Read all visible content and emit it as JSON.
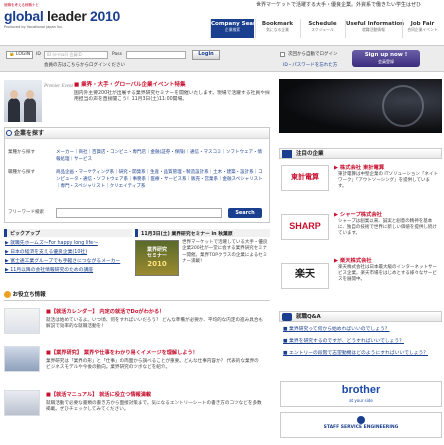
{
  "header": {
    "logo_small": "就職を考える就職ナビ",
    "logo_main_a": "global ",
    "logo_main_b": "leader",
    "logo_main_c": " 2010",
    "logo_sub": "Produced by Vocational Japan Inc.",
    "tagline": "世界マーケットで活躍する大手・優良企業。外資系で働きたい学生はぜひ",
    "nav": [
      {
        "label": "Company Search",
        "sub": "企業検索",
        "active": true
      },
      {
        "label": "Bookmark",
        "sub": "気になる企業",
        "active": false
      },
      {
        "label": "Schedule",
        "sub": "スケジュール",
        "active": false
      },
      {
        "label": "Useful Information",
        "sub": "就職活動情報",
        "active": false
      },
      {
        "label": "Job Fair",
        "sub": "合同企業イベント",
        "active": false
      }
    ]
  },
  "login": {
    "tag": "LOGIN",
    "id_label": "ID",
    "id_placeholder": "ID (e-mail) 会員ID",
    "pass_label": "Pass",
    "pass_placeholder": "",
    "button": "Login",
    "note": "会員の方はこちらからログインください",
    "auto_login": "次回から自動でログイン",
    "forgot": "ID・パスワードを忘れた方",
    "signup": "Sign up now !",
    "signup_sub": "会員登録"
  },
  "hero": {
    "tag": "Premier Event",
    "title": "■ 業界・大手・グローバル企業イベント特集",
    "text": "国内外主要200社が出展する業界研究セミナーを開催いたします。現場で活躍する社員や採用担当の声を直接聞こう！11月3日(土)11:00開場。"
  },
  "search": {
    "title": "企業を探す",
    "rows": [
      {
        "label": "業種から探す",
        "links": "メーカー｜商社｜百貨店・コンビニ・専門店｜金融(証券・保険)｜通信・マスコミ｜ソフトウェア・情報処理｜サービス"
      },
      {
        "label": "職種から探す",
        "links": "商品企画・マーケティング系｜研究・開発系｜生産・品質管理・製造設計系｜土木・建築・設計系｜コンピュータ・通信・ソフトウェア系｜事務系｜医療・サービス系｜販売・営業系｜金融スペシャリスト｜専門・スペシャリスト｜クリエイティブ系"
      },
      {
        "label": "フリーワード検索",
        "links": ""
      }
    ],
    "button": "Search"
  },
  "pickup": {
    "left_title": "ピックアップ",
    "left_items": [
      "▶ 就職先ホームズ〜For happy long life〜",
      "▶ 日本の経済を支える優良企業(10社)",
      "▶ 富士通工業グループでも手軽さにつながるメーカー",
      "▶ 11月以降の会社情報研究のための講座"
    ],
    "right_title": "11月3日(土) 業界研究セミナー in 秋葉原",
    "right_text": "世界マーケットで活躍している大手・優良企業200社が一堂に会する業界研究セミナー開催。業界TOPクラスの企業によるセミナー満載！",
    "seminar_line1": "業界研究",
    "seminar_line2": "セミナー",
    "seminar_line3": "2010"
  },
  "news": {
    "title": "お役立ち情報",
    "items": [
      {
        "title": "■【就活カレンダー】 内定の就活でDoがわかる！",
        "body": "就活は始めているよ。いつ頃、何をすればいいだろう？ どんな準備が必要か、平均的な内定の進み具合も解説で効率的な就職活動を！"
      },
      {
        "title": "■【業界研究】 業界や仕事をわかり易くイメージを理解しよう！",
        "body": "業界研究は「業界の形」と「仕事」の両面から調べることが重要。どんな仕事内容か？ 代表的な業界のビジネスモデルや今後の動向。業界研究のツボなどを紹介。"
      },
      {
        "title": "■【就活マニュアル】 就活に役立つ情報満載",
        "body": "就職活動で必要な書類の書き方から面接対策まで。気になるエントリーシートの書き方のコツなどを多数掲載。ぜひチェックしてみてください。"
      }
    ]
  },
  "sidebar": {
    "companies_title": "注目の企業",
    "companies": [
      {
        "logo": "東計電算",
        "name": "▶ 株式会社 東計電算",
        "desc": "東計電算は中堅企業の ITソリューション「ネイトワーク」「アウトソーシング」を提供しています。"
      },
      {
        "logo": "SHARP",
        "name": "▶ シャープ株式会社",
        "desc": "シャープは創業以来、誠実と創意の精神を基本に、独自の技術で世界に新しい価値を提供し続けています。"
      },
      {
        "logo": "楽天",
        "name": "▶ 楽天株式会社",
        "desc": "楽天株式会社は日本最大級のインターネットサービス企業。楽天市場をはじめとする様々なサービスを展開中。"
      }
    ],
    "qa_title": "就職Q&A",
    "qa_items": [
      "■ 業界研究って何から始めればいいのでしょう？",
      "■ 業界を研究するのですが、どうすればいいでしょう？",
      "■ エントリーの段階で志望動機はどのようにすればいいでしょう？"
    ],
    "ad1": "brother",
    "ad1_sub": "at your side",
    "ad2": "STAFF SERVICE ENGINEERING"
  },
  "colors": {
    "brand_blue": "#1a3f8f",
    "accent_red": "#c8102e",
    "signup_purple": "#3b2d7d"
  }
}
